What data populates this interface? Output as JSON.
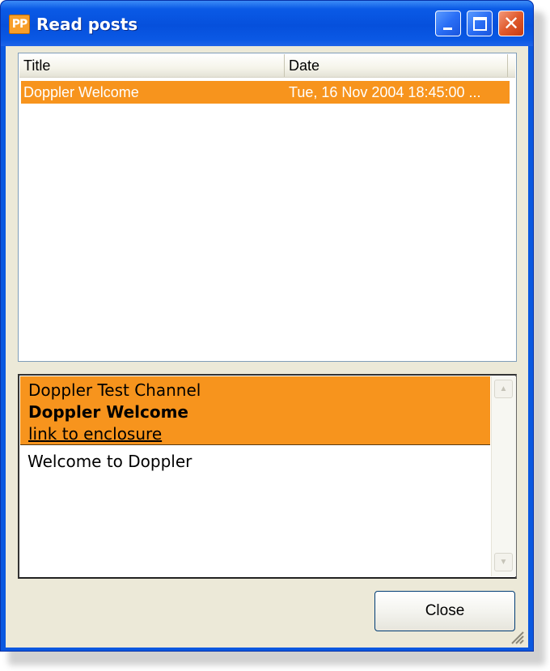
{
  "window": {
    "title": "Read posts",
    "app_icon_text": "PP"
  },
  "list": {
    "columns": [
      "Title",
      "Date"
    ],
    "rows": [
      {
        "title": "Doppler Welcome",
        "date": "Tue, 16 Nov 2004 18:45:00 ...",
        "selected": true
      }
    ]
  },
  "preview": {
    "channel": "Doppler Test Channel",
    "post_title": "Doppler Welcome",
    "link_text": "link to enclosure",
    "body": "Welcome to Doppler"
  },
  "buttons": {
    "close_label": "Close"
  },
  "colors": {
    "selection": "#f7941d",
    "titlebar": "#0a58e0",
    "client_bg": "#ece9d8"
  }
}
